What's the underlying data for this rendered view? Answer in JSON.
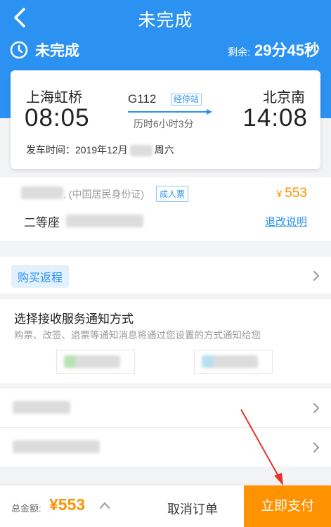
{
  "nav": {
    "title": "未完成"
  },
  "status": {
    "text": "未完成",
    "remaining_label": "剩余:",
    "remaining_value": "29分45秒"
  },
  "ticket": {
    "from_station": "上海虹桥",
    "depart_time": "08:05",
    "to_station": "北京南",
    "arrive_time": "14:08",
    "train_no": "G112",
    "via_label": "经停站",
    "duration": "历时6小时3分",
    "depart_date_prefix": "发车时间：2019年12月",
    "depart_weekday": "周六"
  },
  "passenger": {
    "id_type": ". (中国居民身份证)",
    "ticket_type": "成人票",
    "currency": "¥",
    "price": "553",
    "seat_class": "二等座",
    "refund_label": "退改说明"
  },
  "return_trip": {
    "label": "购买返程"
  },
  "notify": {
    "title": "选择接收服务通知方式",
    "desc": "购票、改签、退票等通知消息将通过您设置的方式通知给您"
  },
  "footer": {
    "total_label": "总金额:",
    "total_value": "¥553",
    "cancel_label": "取消订单",
    "pay_label": "立即支付"
  },
  "colors": {
    "primary": "#2b92f2",
    "accent": "#ff9200",
    "annotation": "#e8322a"
  }
}
